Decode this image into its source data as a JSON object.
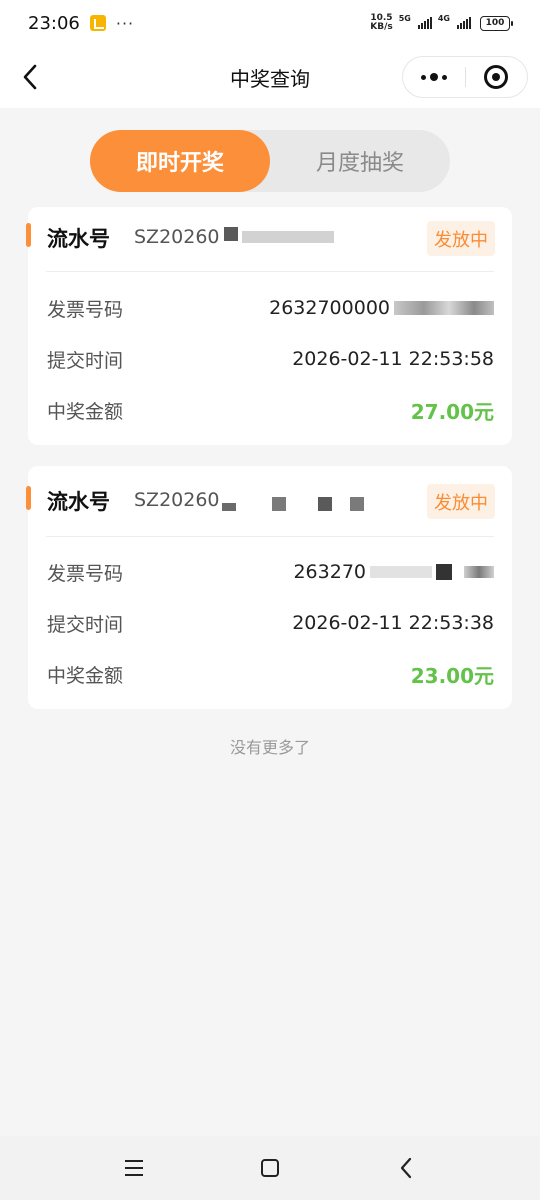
{
  "status_bar": {
    "time": "23:06",
    "more": "···",
    "net_speed_value": "10.5",
    "net_speed_unit": "KB/s",
    "signal1_type": "5G",
    "signal2_type": "4G",
    "battery": "100"
  },
  "nav": {
    "title": "中奖查询",
    "back_icon": "chevron-left-icon",
    "more_icon": "more-dots-icon",
    "close_icon": "target-circle-icon"
  },
  "tabs": [
    {
      "label": "即时开奖",
      "active": true
    },
    {
      "label": "月度抽奖",
      "active": false
    }
  ],
  "records": [
    {
      "serial_label": "流水号",
      "serial_value": "SZ20260",
      "status": "发放中",
      "invoice_label": "发票号码",
      "invoice_value": "2632700000",
      "time_label": "提交时间",
      "time_value": "2026-02-11 22:53:58",
      "amount_label": "中奖金额",
      "amount_value": "27.00元"
    },
    {
      "serial_label": "流水号",
      "serial_value": "SZ20260",
      "status": "发放中",
      "invoice_label": "发票号码",
      "invoice_value": "263270",
      "time_label": "提交时间",
      "time_value": "2026-02-11 22:53:38",
      "amount_label": "中奖金额",
      "amount_value": "23.00元"
    }
  ],
  "footer": {
    "no_more": "没有更多了"
  },
  "colors": {
    "accent": "#fc8f3a",
    "badge_bg": "#fdf1e5",
    "amount": "#62c24a",
    "page_bg": "#f5f5f5"
  },
  "system_nav": {
    "menu_icon": "menu-icon",
    "home_icon": "home-icon",
    "back_icon": "back-icon"
  }
}
